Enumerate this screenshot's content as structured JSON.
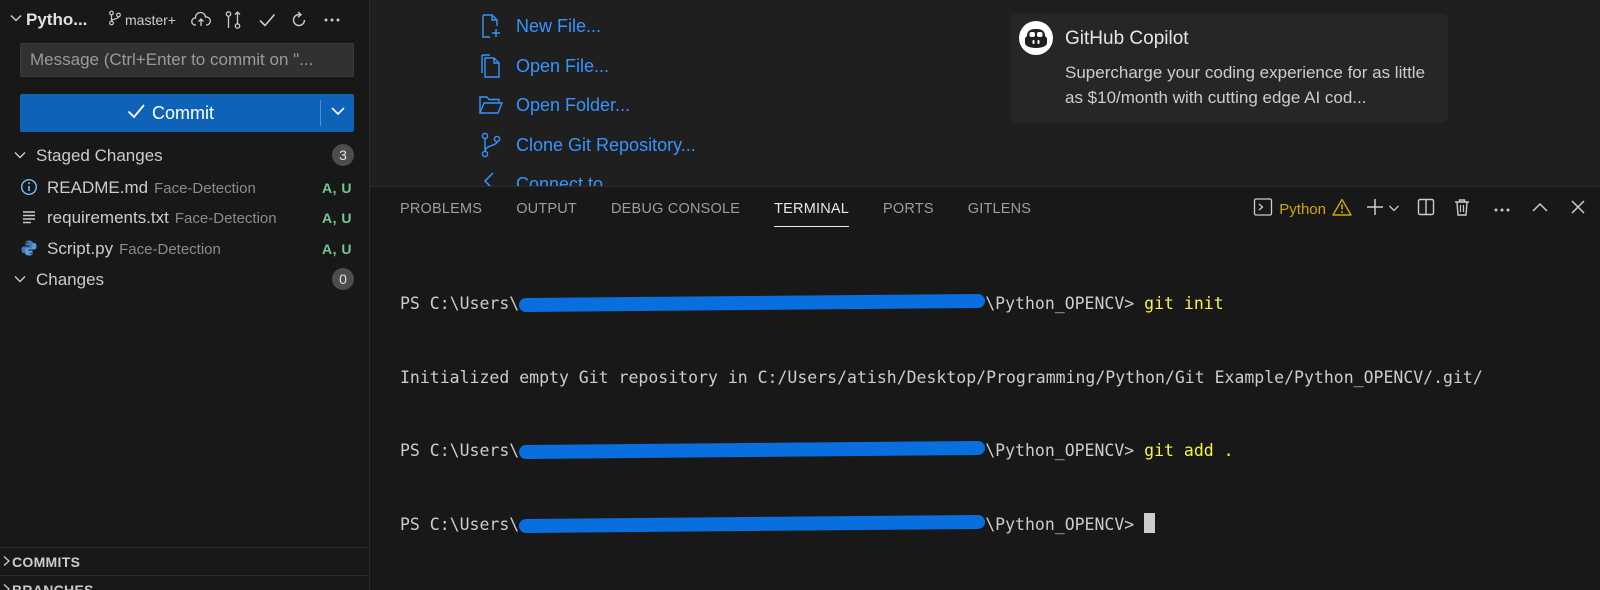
{
  "source_control": {
    "repo_title": "Pytho...",
    "branch": "master+",
    "message_placeholder": "Message (Ctrl+Enter to commit on \"...",
    "commit_label": "Commit",
    "staged": {
      "label": "Staged Changes",
      "count": "3",
      "files": [
        {
          "name": "README.md",
          "dir": "Face-Detection",
          "status": "A, U",
          "icon": "info-icon"
        },
        {
          "name": "requirements.txt",
          "dir": "Face-Detection",
          "status": "A, U",
          "icon": "lines-icon"
        },
        {
          "name": "Script.py",
          "dir": "Face-Detection",
          "status": "A, U",
          "icon": "python-icon"
        }
      ]
    },
    "changes": {
      "label": "Changes",
      "count": "0"
    },
    "commits_label": "COMMITS",
    "branches_label": "BRANCHES"
  },
  "welcome": {
    "start_items": [
      {
        "label": "New File...",
        "icon": "new-file-icon"
      },
      {
        "label": "Open File...",
        "icon": "open-file-icon"
      },
      {
        "label": "Open Folder...",
        "icon": "open-folder-icon"
      },
      {
        "label": "Clone Git Repository...",
        "icon": "git-clone-icon"
      },
      {
        "label": "Connect to...",
        "icon": "remote-icon"
      }
    ],
    "copilot": {
      "title": "GitHub Copilot",
      "description": "Supercharge your coding experience for as little as $10/month with cutting edge AI cod..."
    }
  },
  "panel": {
    "tabs": [
      "PROBLEMS",
      "OUTPUT",
      "DEBUG CONSOLE",
      "TERMINAL",
      "PORTS",
      "GITLENS"
    ],
    "active_tab": "TERMINAL",
    "terminal_name": "Python",
    "terminal": {
      "prompt_prefix": "PS C:\\Users\\",
      "prompt_suffix": "\\Python_OPENCV> ",
      "line1_cmd": "git init",
      "line2": "Initialized empty Git repository in C:/Users/atish/Desktop/Programming/Python/Git Example/Python_OPENCV/.git/",
      "line3_cmd": "git add ."
    }
  },
  "colors": {
    "accent_blue": "#0e63b8",
    "link_blue": "#3794ff",
    "status_green": "#73c991",
    "command_yellow": "#f5f543",
    "warning_yellow": "#cca700",
    "redaction_blue": "#0a6fde"
  }
}
